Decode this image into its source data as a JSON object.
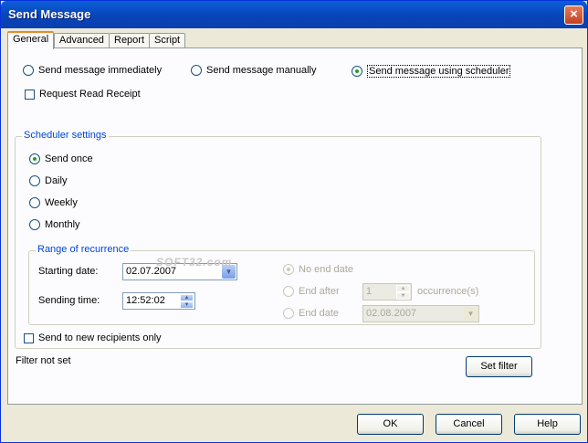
{
  "window": {
    "title": "Send Message",
    "close_glyph": "×"
  },
  "tabs": [
    "General",
    "Advanced",
    "Report",
    "Script"
  ],
  "send_mode": {
    "immediately": "Send message immediately",
    "manually": "Send message manually",
    "scheduler": "Send message using scheduler",
    "selected": "scheduler"
  },
  "read_receipt": {
    "label": "Request Read Receipt",
    "checked": false
  },
  "scheduler": {
    "group_label": "Scheduler settings",
    "once": "Send once",
    "daily": "Daily",
    "weekly": "Weekly",
    "monthly": "Monthly",
    "selected": "once"
  },
  "range": {
    "group_label": "Range of recurrence",
    "starting_date_label": "Starting date:",
    "starting_date_value": "02.07.2007",
    "sending_time_label": "Sending time:",
    "sending_time_value": "12:52:02",
    "no_end_date": "No end date",
    "end_after": "End after",
    "end_after_value": "1",
    "occurrences": "occurrence(s)",
    "end_date": "End date",
    "end_date_value": "02.08.2007"
  },
  "new_recipients": {
    "label": "Send to new recipients only",
    "checked": false
  },
  "filter_status": "Filter not set",
  "watermark": "SOFT32.com",
  "buttons": {
    "set_filter": "Set filter",
    "ok": "OK",
    "cancel": "Cancel",
    "help": "Help"
  },
  "colors": {
    "title_bar": "#0a5fd8",
    "group_label": "#0046d5",
    "radio_dot": "#21a121",
    "active_tab_accent": "#e68b2c"
  }
}
